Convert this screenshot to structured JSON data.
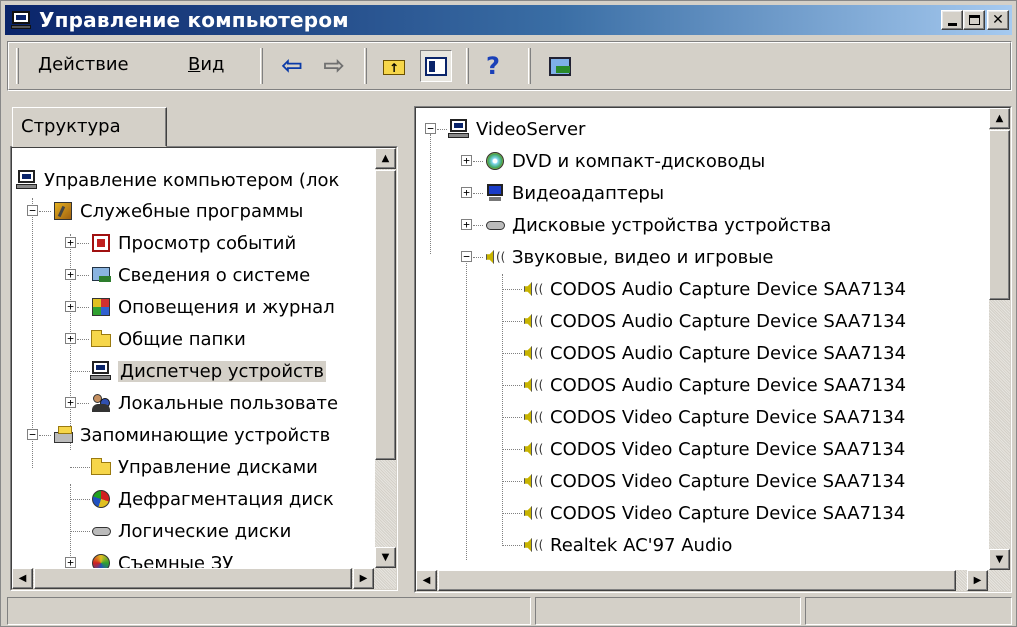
{
  "window": {
    "title": "Управление компьютером",
    "controls": {
      "minimize": "minimize",
      "maximize": "maximize",
      "close": "close"
    }
  },
  "toolbar": {
    "menu_action": "Действие",
    "menu_action_hotkey": "Д",
    "menu_action_rest": "ействие",
    "menu_view_hotkey": "В",
    "menu_view_rest": "ид",
    "menu_view": "Вид",
    "buttons": [
      "back-arrow-icon",
      "forward-arrow-icon",
      "up-folder-icon",
      "show-hide-tree-icon",
      "help-icon",
      "computer-management-icon"
    ]
  },
  "left_pane": {
    "tab_label": "Структура",
    "items": [
      {
        "label": "Управление компьютером (лок",
        "icon": "computer-icon"
      },
      {
        "label": "Служебные программы",
        "icon": "tools-icon"
      },
      {
        "label": "Просмотр событий",
        "icon": "event-viewer-icon"
      },
      {
        "label": "Сведения о системе",
        "icon": "system-info-icon"
      },
      {
        "label": "Оповещения и журнал",
        "icon": "alerts-icon"
      },
      {
        "label": "Общие папки",
        "icon": "folder-icon"
      },
      {
        "label": "Диспетчер устройств",
        "icon": "device-manager-icon",
        "selected": true
      },
      {
        "label": "Локальные пользовате",
        "icon": "users-icon"
      },
      {
        "label": "Запоминающие устройств",
        "icon": "storage-icon"
      },
      {
        "label": "Управление дисками",
        "icon": "folder-icon"
      },
      {
        "label": "Дефрагментация диск",
        "icon": "defrag-icon"
      },
      {
        "label": "Логические диски",
        "icon": "drive-icon"
      },
      {
        "label": "Съемные ЗУ",
        "icon": "media-icon"
      }
    ]
  },
  "right_pane": {
    "root": "VideoServer",
    "categories": [
      {
        "label": "DVD и компакт-дисководы",
        "icon": "dvd-icon"
      },
      {
        "label": "Видеоадаптеры",
        "icon": "monitor-icon"
      },
      {
        "label": "Дисковые устройства устройства",
        "icon": "disk-drive-icon"
      },
      {
        "label": "Звуковые, видео и игровые",
        "icon": "sound-icon"
      }
    ],
    "devices": [
      "CODOS Audio Capture Device SAA7134",
      "CODOS Audio Capture Device SAA7134",
      "CODOS Audio Capture Device SAA7134",
      "CODOS Audio Capture Device SAA7134",
      "CODOS Video Capture Device SAA7134",
      "CODOS Video Capture Device SAA7134",
      "CODOS Video Capture Device SAA7134",
      "CODOS Video Capture Device SAA7134",
      "Realtek AC'97 Audio"
    ]
  },
  "statusbar": {
    "cells": [
      "",
      "",
      ""
    ]
  },
  "colors": {
    "title_start": "#0a246a",
    "title_end": "#a6caf0",
    "face": "#d4d0c8",
    "selection": "#d4d0c8"
  }
}
